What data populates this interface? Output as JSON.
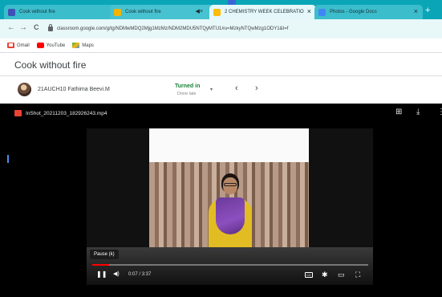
{
  "browser": {
    "tabs": [
      {
        "title": "Cook without fire",
        "color": "#3f51b5"
      },
      {
        "title": "Cook without fire",
        "color": "#f4b400"
      },
      {
        "title": "2 CHEMISTRY WEEK CELEBRATIO",
        "color": "#fbbc04"
      },
      {
        "title": "Photos - Google Docs",
        "color": "#4285f4"
      }
    ],
    "url": "classroom.google.com/g/tg/NDMwMDQ2Mjg1MzMz/NDM2MDU5NTQyMTU1#u=MzkyNTQwMzg1ODY1&t=f",
    "bookmarks": [
      {
        "label": "Gmail",
        "color": "#ea4335"
      },
      {
        "label": "YouTube",
        "color": "#ff0000"
      },
      {
        "label": "Maps",
        "color": "#34a853"
      }
    ],
    "icons": {
      "back": "←",
      "forward": "→",
      "reload": "C",
      "close": "×",
      "new_tab": "+",
      "audio": "◀×"
    }
  },
  "classroom": {
    "title": "Cook without fire",
    "student": "21AUCH10 Fathima Beevi.M",
    "status": "Turned in",
    "status_sub": "Done late",
    "caret": "▾",
    "prev": "‹",
    "next": "›"
  },
  "viewer": {
    "file_name": "InShot_20211203_182926243.mp4",
    "comment_icon": "⊞",
    "download_icon": "⤓",
    "more_icon": "⋮",
    "tooltip": "Pause (k)",
    "time": "0:07 / 3:37",
    "controls": {
      "pause": "❚❚",
      "volume": "◀)",
      "cc": "CC",
      "settings": "✱",
      "miniplayer": "▭",
      "fullscreen": "⛶"
    },
    "progress": 0.06
  }
}
